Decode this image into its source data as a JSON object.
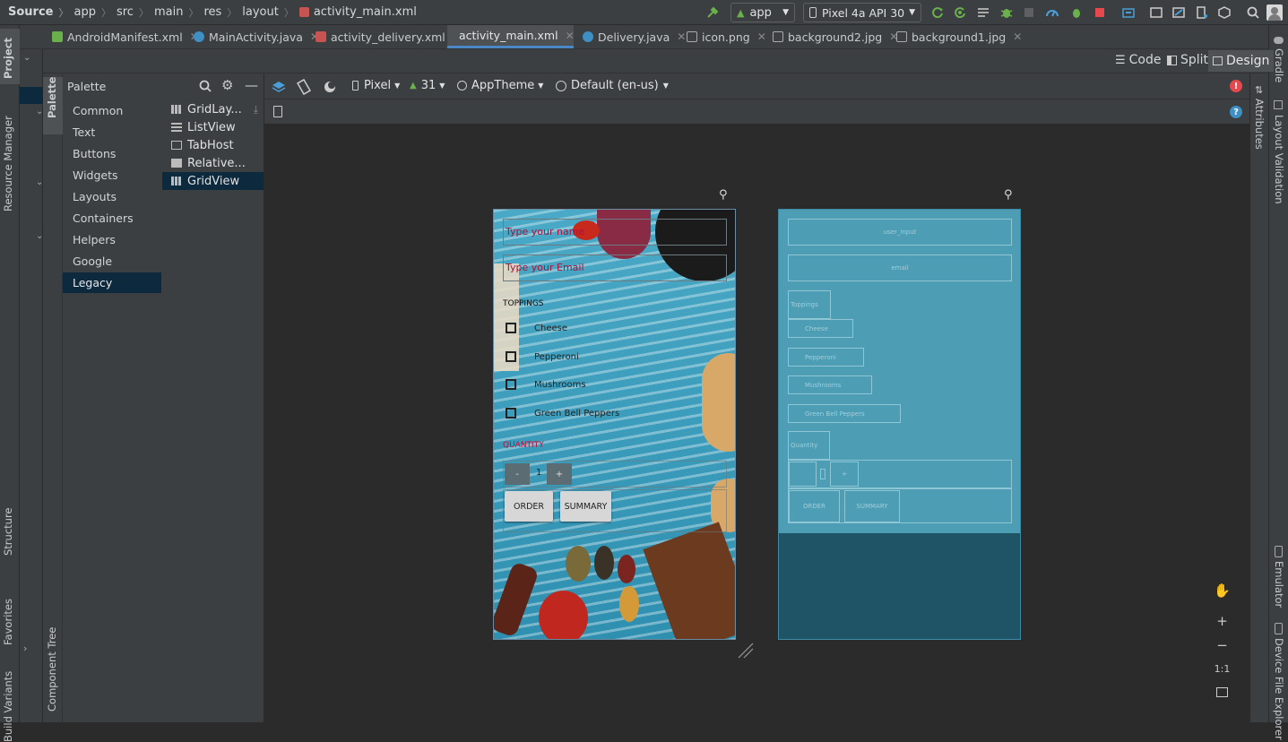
{
  "breadcrumb": [
    "Source",
    "app",
    "src",
    "main",
    "res",
    "layout",
    "activity_main.xml"
  ],
  "run_config": "app",
  "device": "Pixel 4a API 30",
  "tabs": [
    {
      "label": "AndroidManifest.xml",
      "active": false
    },
    {
      "label": "MainActivity.java",
      "active": false
    },
    {
      "label": "activity_delivery.xml",
      "active": false
    },
    {
      "label": "activity_main.xml",
      "active": true
    },
    {
      "label": "Delivery.java",
      "active": false
    },
    {
      "label": "icon.png",
      "active": false
    },
    {
      "label": "background2.jpg",
      "active": false
    },
    {
      "label": "background1.jpg",
      "active": false
    }
  ],
  "view_modes": {
    "code": "Code",
    "split": "Split",
    "design": "Design"
  },
  "left_tools": {
    "project": "Project",
    "resource_manager": "Resource Manager",
    "structure": "Structure",
    "favorites": "Favorites",
    "build_variants": "Build Variants"
  },
  "right_tools": {
    "gradle": "Gradle",
    "layout_validation": "Layout Validation",
    "emulator": "Emulator",
    "device_file_explorer": "Device File Explorer"
  },
  "palette": {
    "title": "Palette",
    "strip_label": "Palette",
    "component_tree": "Component Tree",
    "categories": [
      "Common",
      "Text",
      "Buttons",
      "Widgets",
      "Layouts",
      "Containers",
      "Helpers",
      "Google",
      "Legacy"
    ],
    "selected_category": "Legacy",
    "items": [
      "GridLay...",
      "ListView",
      "TabHost",
      "Relative...",
      "GridView"
    ],
    "selected_item": "GridView"
  },
  "canvas_toolbar": {
    "device": "Pixel",
    "api": "31",
    "theme": "AppTheme",
    "locale": "Default (en-us)",
    "attributes": "Attributes"
  },
  "design": {
    "name_hint": "Type your name",
    "email_hint": "Type your Email",
    "toppings_label": "TOPPINGS",
    "toppings": [
      "Cheese",
      "Pepperoni",
      "Mushrooms",
      "Green Bell Peppers"
    ],
    "quantity_label": "QUANTITY",
    "minus": "-",
    "quantity": "1",
    "plus": "+",
    "order": "ORDER",
    "summary": "SUMMARY"
  },
  "blueprint": {
    "user_input": "user_input",
    "email": "email",
    "toppings": "Toppings",
    "items": [
      "Cheese",
      "Pepperoni",
      "Mushrooms",
      "Green Bell Peppers"
    ],
    "quantity": "Quantity",
    "minus": "-",
    "plus": "+",
    "order": "ORDER",
    "summary": "SUMMARY"
  },
  "zoom": {
    "in": "+",
    "out": "−",
    "one_to_one": "1:1"
  },
  "colors": {
    "accent": "#4a88c7",
    "selection": "#0d293e",
    "error": "#e5484d",
    "android_green": "#6ab04c"
  }
}
